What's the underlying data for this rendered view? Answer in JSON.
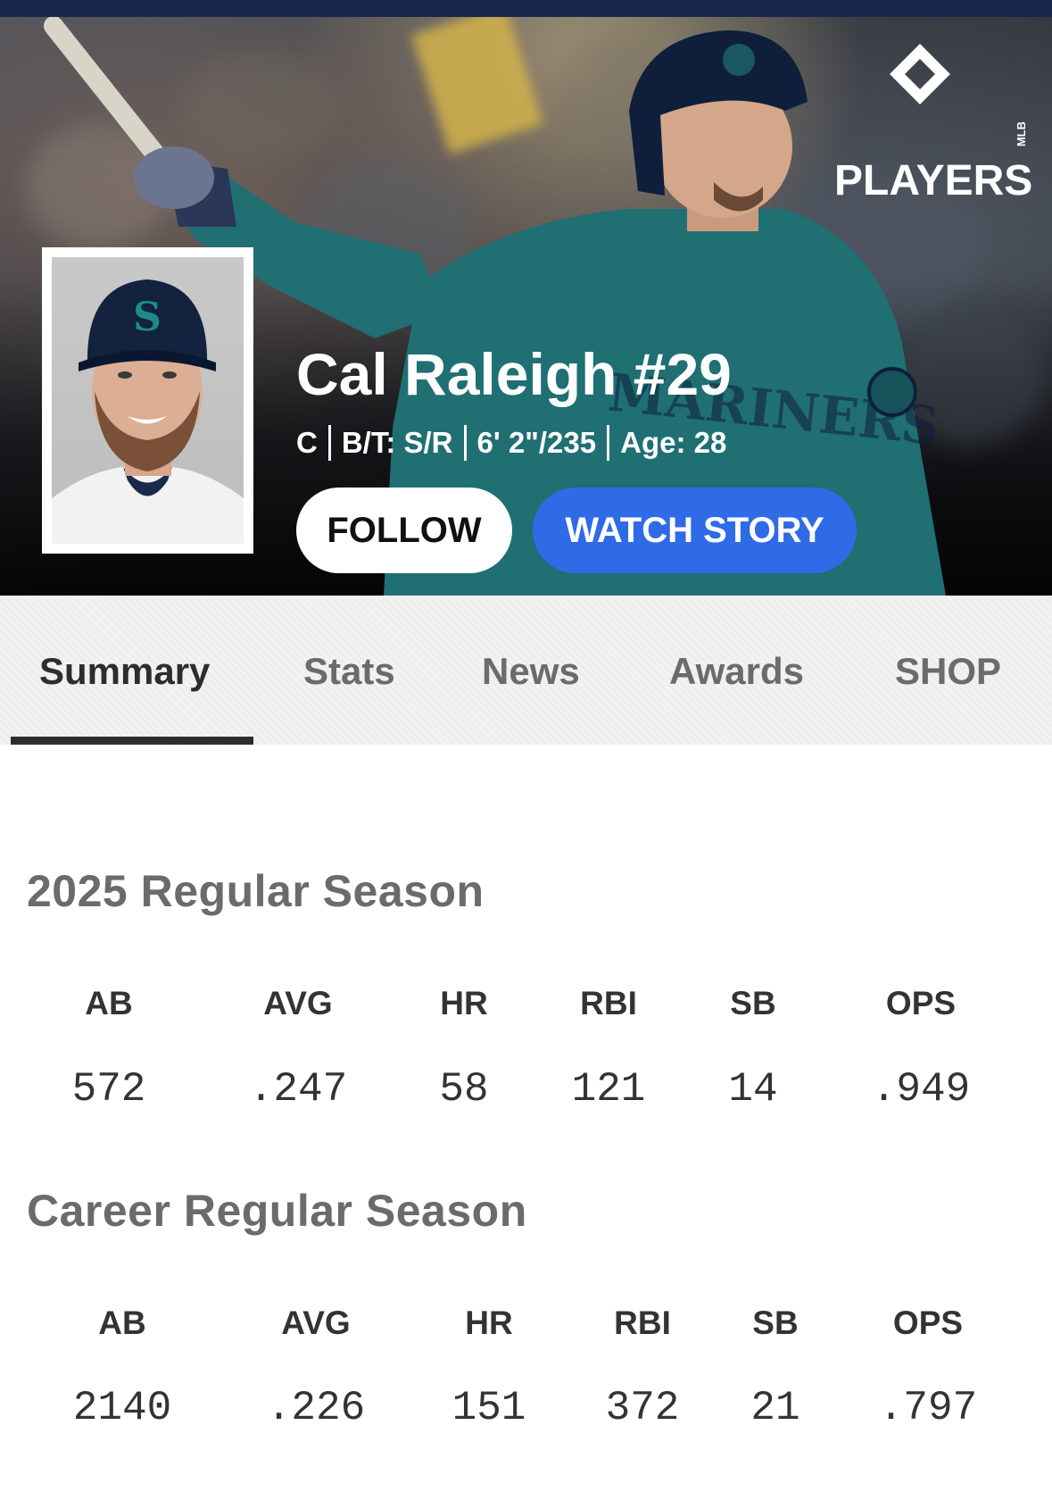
{
  "header": {
    "brand_logo": "MLB PLAYERS",
    "logo_small": "MLB",
    "logo_main": "PLAYERS",
    "background_colors": {
      "strip": "#17284b"
    }
  },
  "player": {
    "name": "Cal Raleigh #29",
    "position": "C",
    "bats_throws": "B/T: S/R",
    "height_weight": "6' 2\"/235",
    "age": "Age: 28"
  },
  "actions": {
    "follow_label": "FOLLOW",
    "watch_story_label": "WATCH STORY",
    "accent_color": "#2f6be6"
  },
  "tabs": [
    {
      "label": "Summary",
      "active": true
    },
    {
      "label": "Stats",
      "active": false
    },
    {
      "label": "News",
      "active": false
    },
    {
      "label": "Awards",
      "active": false
    },
    {
      "label": "SHOP",
      "active": false
    }
  ],
  "season": {
    "title": "2025 Regular Season",
    "columns": [
      "AB",
      "AVG",
      "HR",
      "RBI",
      "SB",
      "OPS"
    ],
    "values": [
      "572",
      ".247",
      "58",
      "121",
      "14",
      ".949"
    ]
  },
  "career": {
    "title": "Career Regular Season",
    "columns": [
      "AB",
      "AVG",
      "HR",
      "RBI",
      "SB",
      "OPS"
    ],
    "values": [
      "2140",
      ".226",
      "151",
      "372",
      "21",
      ".797"
    ]
  }
}
